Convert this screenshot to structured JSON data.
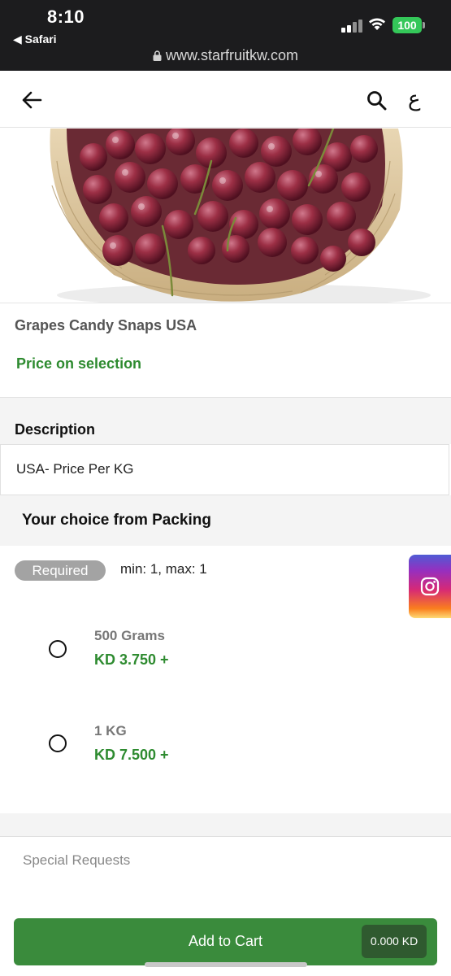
{
  "status_bar": {
    "time": "8:10",
    "back_app": "◀ Safari",
    "battery": "100",
    "url": "www.starfruitkw.com"
  },
  "header": {
    "back_icon": "arrow-left-icon",
    "search_icon": "search-icon",
    "language_toggle": "ع"
  },
  "product": {
    "image": "grapes-basket-image",
    "title": "Grapes Candy Snaps USA",
    "price_note": "Price on selection"
  },
  "description": {
    "heading": "Description",
    "text": "USA- Price Per KG"
  },
  "packing": {
    "heading": "Your choice from Packing",
    "required_badge": "Required",
    "constraint": "min: 1, max: 1",
    "options": [
      {
        "name": "500 Grams",
        "price": "KD 3.750 +",
        "selected": false
      },
      {
        "name": "1 KG",
        "price": "KD 7.500 +",
        "selected": false
      }
    ]
  },
  "special_requests": {
    "placeholder": "Special Requests"
  },
  "cart": {
    "button_label": "Add to Cart",
    "total": "0.000 KD"
  },
  "social": {
    "instagram_icon": "instagram-icon"
  },
  "colors": {
    "accent_green": "#2e8b30",
    "button_green": "#3a8b3c",
    "status_bar": "#1c1c1e"
  }
}
